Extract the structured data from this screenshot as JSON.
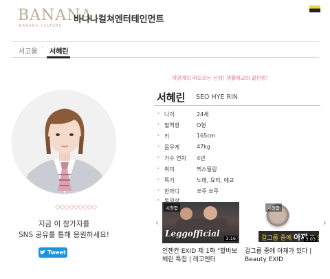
{
  "header": {
    "logo_text": "BANANA",
    "logo_sub": "BANANA CULTURE",
    "company_name": "바나나컬쳐엔터테인먼트"
  },
  "tabs": {
    "tab1": "서고울",
    "separator": "·",
    "tab2": "서혜린"
  },
  "profile": {
    "slogan": "막앙계의 떠오르는 신성! 생활애교의 끝판왕!",
    "name_ko": "서혜린",
    "name_en": "SEO HYE RIN",
    "info": [
      {
        "label": "나이",
        "value": "24세"
      },
      {
        "label": "혈액형",
        "value": "O형"
      },
      {
        "label": "키",
        "value": "165cm"
      },
      {
        "label": "몸무게",
        "value": "47kg"
      },
      {
        "label": "가수 연차",
        "value": "4년"
      },
      {
        "label": "취미",
        "value": "찍스틸링"
      },
      {
        "label": "특기",
        "value": "노래, 요리, 애교"
      },
      {
        "label": "한마디",
        "value": "쏘주 쏘주"
      },
      {
        "label": "동영상",
        "value": ""
      }
    ]
  },
  "vote": {
    "decoration": "◇◇◇◇◇◇◇◇◇",
    "line1": "지금 이 참가자를",
    "line2": "SNS 공유를 통해 응원하세요!",
    "tweet_label": "Tweet"
  },
  "videos": [
    {
      "badge": "시청함",
      "overlay": "Leggofficial",
      "duration": "3:16",
      "caption": "인젠칸 EXID 제 1화 \"할바보 헤린 특집 | 레고엔터"
    },
    {
      "badge": "시청함",
      "overlay_a": "걸그룹 중에",
      "overlay_b": "아재",
      "overlay_c": "가 있다",
      "duration": "3:03",
      "caption": "걸그룹 중에 아재가 있다 | Beauty EXID"
    }
  ],
  "nav": {
    "prev": "‹",
    "next": "›"
  },
  "colors": {
    "accent_pink": "#e0718d",
    "tweet_blue": "#1b95e0",
    "logo_gold": "#b8ae96"
  }
}
